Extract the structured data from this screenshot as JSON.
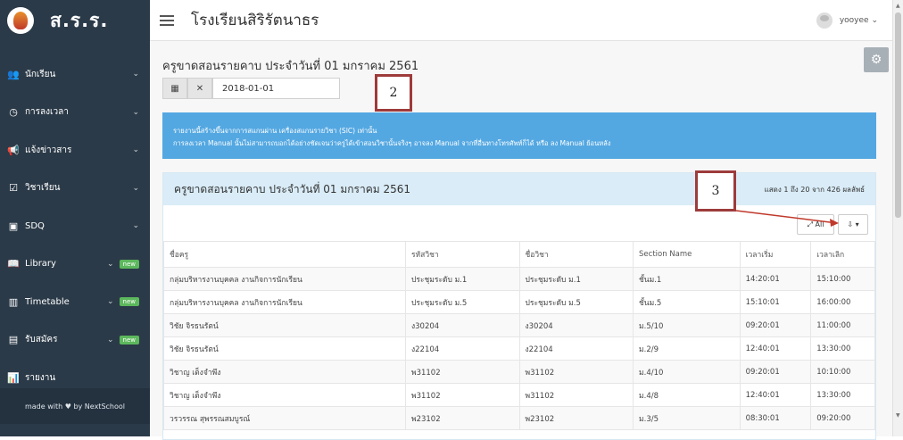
{
  "sidebar": {
    "brand": "ส.ร.ร.",
    "items": [
      {
        "label": "นักเรียน",
        "icon": "users-icon",
        "glyph": "👥",
        "badge": ""
      },
      {
        "label": "การลงเวลา",
        "icon": "clock-icon",
        "glyph": "◷",
        "badge": ""
      },
      {
        "label": "แจ้งข่าวสาร",
        "icon": "megaphone-icon",
        "glyph": "📢",
        "badge": ""
      },
      {
        "label": "วิชาเรียน",
        "icon": "calendar-check-icon",
        "glyph": "☑",
        "badge": ""
      },
      {
        "label": "SDQ",
        "icon": "list-box-icon",
        "glyph": "▣",
        "badge": ""
      },
      {
        "label": "Library",
        "icon": "book-icon",
        "glyph": "📖",
        "badge": "new"
      },
      {
        "label": "Timetable",
        "icon": "table-icon",
        "glyph": "▥",
        "badge": "new"
      },
      {
        "label": "รับสมัคร",
        "icon": "form-icon",
        "glyph": "▤",
        "badge": "new"
      },
      {
        "label": "รายงาน",
        "icon": "bar-chart-icon",
        "glyph": "📊",
        "badge": ""
      }
    ],
    "footer": "made with ♥ by NextSchool"
  },
  "topbar": {
    "school": "โรงเรียนสิริรัตนาธร",
    "user": "yooyee ⌄"
  },
  "page": {
    "heading": "ครูขาดสอนรายคาบ ประจำวันที่ 01 มกราคม 2561",
    "date_value": "2018-01-01",
    "calendar_glyph": "▦",
    "clear_glyph": "✕",
    "settings_glyph": "⚙",
    "notice_line1": "รายงานนี้สร้างขึ้นจากการสแกนผ่าน เครื่องสแกนรายวิชา (SIC) เท่านั้น",
    "notice_line2": "การลงเวลา Manual นั้นไม่สามารถบอกได้อย่างชัดเจนว่าครูได้เข้าสอนวิชานั้นจริงๆ อาจลง Manual จากที่อื่นทางโทรศัพท์ก็ได้ หรือ ลง Manual ย้อนหลัง"
  },
  "panel": {
    "title": "ครูขาดสอนรายคาบ ประจำวันที่ 01 มกราคม 2561",
    "count": "แสดง 1 ถึง 20 จาก 426 ผลลัพธ์",
    "btn_all": "⤢ All",
    "btn_export": "⇩ ▾"
  },
  "table": {
    "headers": [
      "ชื่อครู",
      "รหัสวิชา",
      "ชื่อวิชา",
      "Section Name",
      "เวลาเริ่ม",
      "เวลาเลิก"
    ],
    "rows": [
      [
        "กลุ่มบริหารงานบุคคล งานกิจการนักเรียน",
        "ประชุมระดับ ม.1",
        "ประชุมระดับ ม.1",
        "ชั้นม.1",
        "14:20:01",
        "15:10:00"
      ],
      [
        "กลุ่มบริหารงานบุคคล งานกิจการนักเรียน",
        "ประชุมระดับ ม.5",
        "ประชุมระดับ ม.5",
        "ชั้นม.5",
        "15:10:01",
        "16:00:00"
      ],
      [
        "วิชัย จิรธนรัตน์",
        "ง30204",
        "ง30204",
        "ม.5/10",
        "09:20:01",
        "11:00:00"
      ],
      [
        "วิชัย จิรธนรัตน์",
        "ง22104",
        "ง22104",
        "ม.2/9",
        "12:40:01",
        "13:30:00"
      ],
      [
        "วิชาญ เต็งจำพึง",
        "พ31102",
        "พ31102",
        "ม.4/10",
        "09:20:01",
        "10:10:00"
      ],
      [
        "วิชาญ เต็งจำพึง",
        "พ31102",
        "พ31102",
        "ม.4/8",
        "12:40:01",
        "13:30:00"
      ],
      [
        "วรวรรณ สุพรรณสมบูรณ์",
        "พ23102",
        "พ23102",
        "ม.3/5",
        "08:30:01",
        "09:20:00"
      ]
    ]
  },
  "annotations": {
    "box2": "2",
    "box3": "3",
    "arrow_color": "#c0392b"
  }
}
